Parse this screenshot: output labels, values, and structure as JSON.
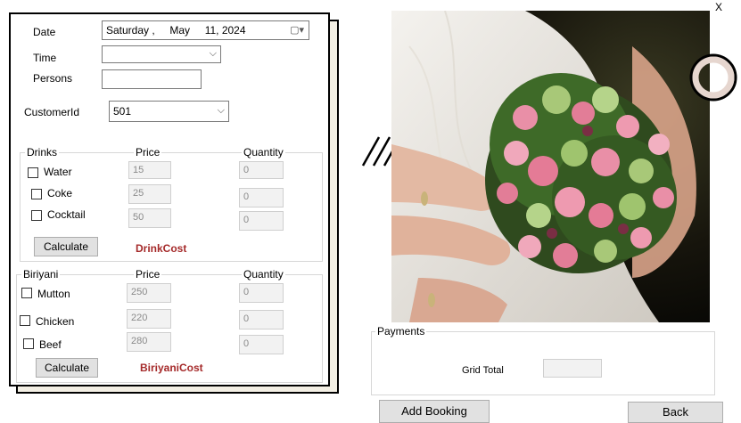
{
  "close_label": "X",
  "form": {
    "date_label": "Date",
    "date_value": "Saturday ,     May     11, 2024",
    "time_label": "Time",
    "time_value": "",
    "persons_label": "Persons",
    "persons_value": "",
    "customer_label": "CustomerId",
    "customer_value": "501"
  },
  "drinks": {
    "group_label": "Drinks",
    "price_header": "Price",
    "quantity_header": "Quantity",
    "items": [
      {
        "label": "Water",
        "price": "15",
        "quantity": "0"
      },
      {
        "label": "Coke",
        "price": "25",
        "quantity": "0"
      },
      {
        "label": "Cocktail",
        "price": "50",
        "quantity": "0"
      }
    ],
    "calculate_label": "Calculate",
    "cost_label": "DrinkCost"
  },
  "biriyani": {
    "group_label": "Biriyani",
    "price_header": "Price",
    "quantity_header": "Quantity",
    "items": [
      {
        "label": "Mutton",
        "price": "250",
        "quantity": "0"
      },
      {
        "label": "Chicken",
        "price": "220",
        "quantity": "0"
      },
      {
        "label": "Beef",
        "price": "280",
        "quantity": "0"
      }
    ],
    "calculate_label": "Calculate",
    "cost_label": "BiriyaniCost"
  },
  "payments": {
    "group_label": "Payments",
    "grid_total_label": "Grid Total",
    "grid_total_value": ""
  },
  "buttons": {
    "add_booking": "Add Booking",
    "back": "Back"
  },
  "colors": {
    "accent_text": "#a52a2a",
    "card_back": "#f3efe4",
    "ring": "#e6d6cf"
  }
}
